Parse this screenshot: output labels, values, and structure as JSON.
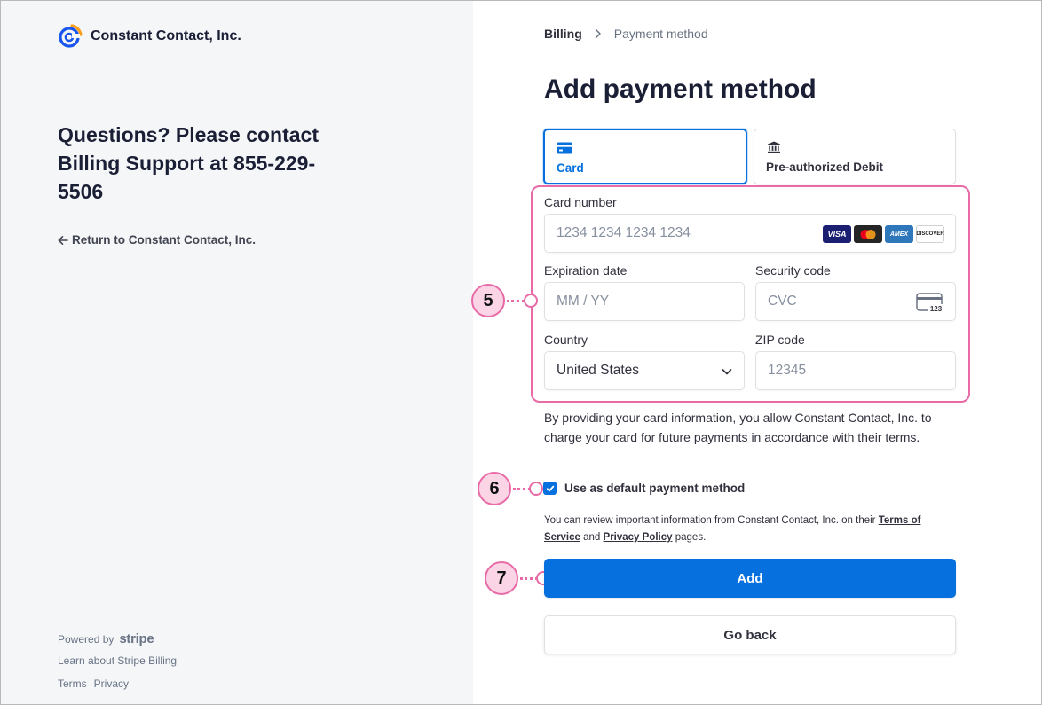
{
  "merchant": {
    "name": "Constant Contact, Inc.",
    "questions": "Questions? Please contact Billing Support at 855-229-5506",
    "return_link": "Return to Constant Contact, Inc.",
    "powered_by": "Powered by",
    "stripe": "stripe",
    "learn": "Learn about Stripe Billing",
    "terms": "Terms",
    "privacy": "Privacy"
  },
  "breadcrumb": {
    "parent": "Billing",
    "current": "Payment method"
  },
  "title": "Add payment method",
  "tabs": [
    {
      "label": "Card",
      "selected": true
    },
    {
      "label": "Pre-authorized Debit",
      "selected": false
    }
  ],
  "form": {
    "card_number_label": "Card number",
    "card_number_placeholder": "1234 1234 1234 1234",
    "brands": [
      "VISA",
      "AMEX",
      "DISCOVER"
    ],
    "expiry_label": "Expiration date",
    "expiry_placeholder": "MM / YY",
    "cvc_label": "Security code",
    "cvc_placeholder": "CVC",
    "cvc_icon_text": "123",
    "country_label": "Country",
    "country_value": "United States",
    "zip_label": "ZIP code",
    "zip_placeholder": "12345"
  },
  "consent": "By providing your card information, you allow Constant Contact, Inc. to charge your card for future payments in accordance with their terms.",
  "default_method": {
    "label": "Use as default payment method",
    "checked": true
  },
  "legal": {
    "prefix": "You can review important information from Constant Contact, Inc. on their",
    "terms": "Terms of Service",
    "and": "and",
    "privacy": "Privacy Policy",
    "suffix": "pages."
  },
  "buttons": {
    "add": "Add",
    "back": "Go back"
  },
  "markers": [
    "5",
    "6",
    "7"
  ],
  "colors": {
    "accent": "#0570de",
    "highlight": "#e86aa6",
    "left_panel_bg": "#f5f6f8"
  }
}
